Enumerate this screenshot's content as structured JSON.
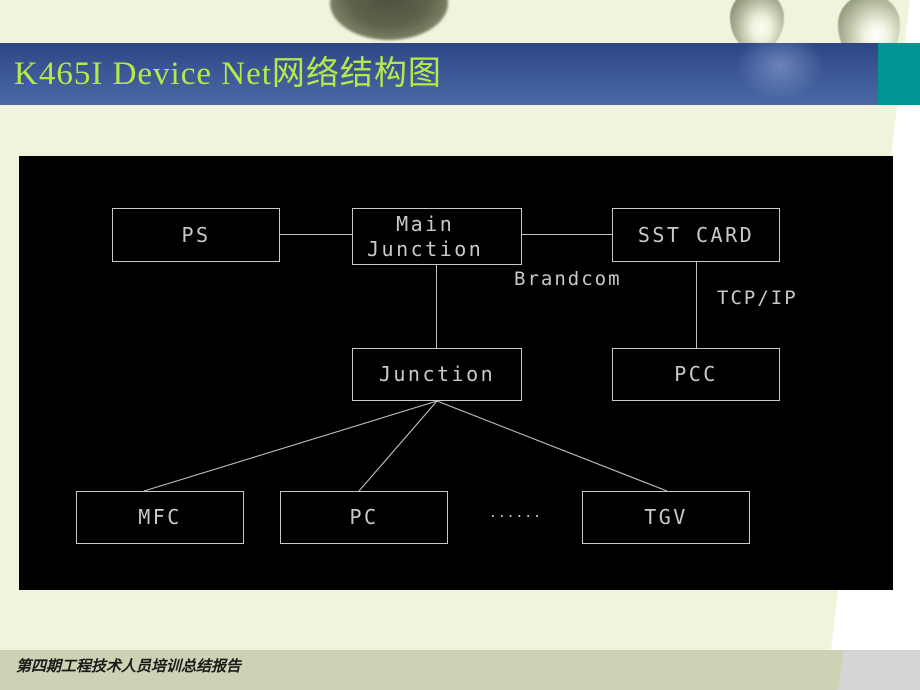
{
  "slide": {
    "title": "K465I Device Net网络结构图",
    "title_color": "#b6e84a",
    "title_bar_color": "#395392",
    "accent_color": "#009595",
    "body_color": "#f0f4dc",
    "footer_text": "第四期工程技术人员培训总结报告",
    "footer_color": "#ccd3b4"
  },
  "diagram": {
    "background": "#000000",
    "stroke": "#c8c8c8",
    "nodes": [
      {
        "id": "ps",
        "label": "PS"
      },
      {
        "id": "main-junction",
        "label": "Main\nJunction"
      },
      {
        "id": "sst-card",
        "label": "SST CARD"
      },
      {
        "id": "junction",
        "label": "Junction"
      },
      {
        "id": "pcc",
        "label": "PCC"
      },
      {
        "id": "mfc",
        "label": "MFC"
      },
      {
        "id": "pc",
        "label": "PC"
      },
      {
        "id": "tgv",
        "label": "TGV"
      }
    ],
    "edge_labels": [
      {
        "id": "brandcom",
        "label": "Brandcom"
      },
      {
        "id": "tcpip",
        "label": "TCP/IP"
      }
    ],
    "ellipsis": "......",
    "connections": [
      {
        "from": "ps",
        "to": "main-junction"
      },
      {
        "from": "main-junction",
        "to": "sst-card",
        "label": "Brandcom"
      },
      {
        "from": "main-junction",
        "to": "junction"
      },
      {
        "from": "sst-card",
        "to": "pcc",
        "label": "TCP/IP"
      },
      {
        "from": "junction",
        "to": "mfc"
      },
      {
        "from": "junction",
        "to": "pc"
      },
      {
        "from": "junction",
        "to": "tgv"
      }
    ]
  }
}
